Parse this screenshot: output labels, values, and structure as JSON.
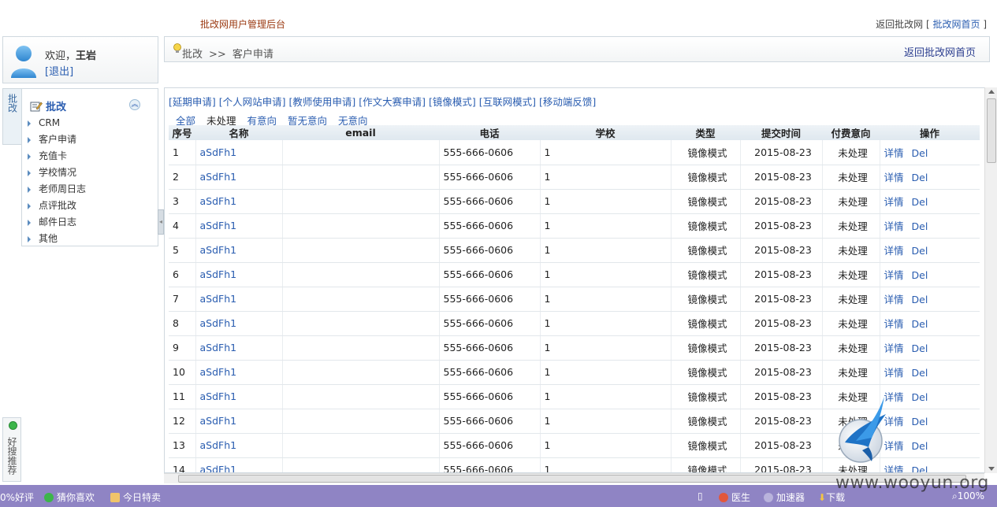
{
  "header": {
    "system_title": "批改网用户管理后台",
    "back_text": "返回批改网",
    "bracket_open": "[",
    "home_link": "批改网首页",
    "bracket_close": "]"
  },
  "user": {
    "welcome_prefix": "欢迎，",
    "name": "王岩",
    "logout": "[退出]"
  },
  "sidebar": {
    "vertical_tab": "批改",
    "section_title": "批改",
    "items": [
      "CRM",
      "客户申请",
      "充值卡",
      "学校情况",
      "老师周日志",
      "点评批改",
      "邮件日志",
      "其他"
    ],
    "bottom_widget": "好搜推荐"
  },
  "breadcrumb": {
    "root": "批改",
    "separator": ">>",
    "current": "客户申请",
    "home_button": "返回批改网首页"
  },
  "main": {
    "top_links": [
      "[延期申请]",
      "[个人网站申请]",
      "[教师使用申请]",
      "[作文大赛申请]",
      "[镜像模式]",
      "[互联网模式]",
      "[移动端反馈]"
    ],
    "filters": [
      "全部",
      "未处理",
      "有意向",
      "暂无意向",
      "无意向"
    ],
    "active_filter": 1,
    "columns": [
      "序号",
      "名称",
      "email",
      "电话",
      "学校",
      "类型",
      "提交时间",
      "付费意向",
      "操作"
    ],
    "row_template": {
      "name": "aSdFh1",
      "email": "",
      "phone": "555-666-0606",
      "school": "1",
      "type": "镜像模式",
      "date": "2015-08-23",
      "status": "未处理",
      "detail": "详情",
      "delete": "Del"
    },
    "row_ids": [
      "1",
      "2",
      "3",
      "4",
      "5",
      "6",
      "7",
      "8",
      "9",
      "10",
      "11",
      "12",
      "13",
      "14"
    ]
  },
  "statusbar": {
    "left_items": [
      "0%好评",
      "猜你喜欢",
      "今日特卖"
    ],
    "right_items": [
      "医生",
      "加速器",
      "下载"
    ],
    "zoom": "100%"
  },
  "watermark": "www.wooyun.org",
  "colors": {
    "accent_link": "#2a5db0",
    "title_red": "#9b3a12",
    "statusbar_bg": "#8f84c4"
  }
}
